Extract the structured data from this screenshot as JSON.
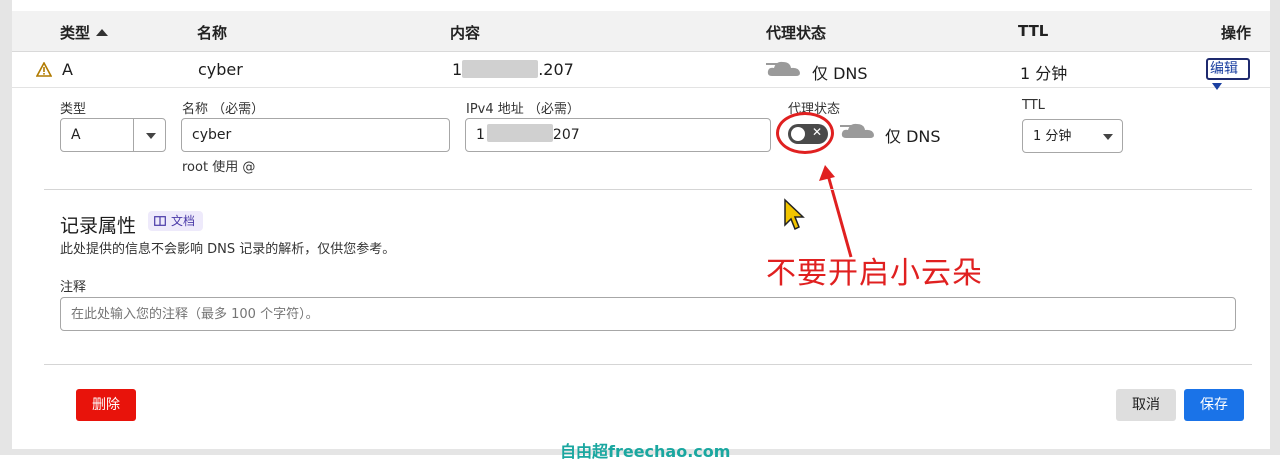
{
  "table": {
    "headers": {
      "type": "类型",
      "name": "名称",
      "content": "内容",
      "proxy": "代理状态",
      "ttl": "TTL",
      "actions": "操作"
    },
    "row": {
      "type": "A",
      "name": "cyber",
      "content_visible": ".207",
      "content_prefix": "1",
      "proxy_status": "仅 DNS",
      "ttl": "1 分钟",
      "edit_label": "编辑"
    }
  },
  "form": {
    "type_label": "类型",
    "type_value": "A",
    "name_label": "名称 （必需）",
    "name_value": "cyber",
    "name_hint": "root 使用 @",
    "ipv4_label": "IPv4 地址 （必需）",
    "ipv4_prefix": "1",
    "ipv4_suffix": "207",
    "proxy_label": "代理状态",
    "proxy_status": "仅 DNS",
    "proxy_toggle_on": false,
    "ttl_label": "TTL",
    "ttl_value": "1 分钟"
  },
  "record_props": {
    "title": "记录属性",
    "doc_label": "文档",
    "description": "此处提供的信息不会影响 DNS 记录的解析，仅供您参考。",
    "comment_label": "注释",
    "comment_placeholder": "在此处输入您的注释（最多 100 个字符）。"
  },
  "actions": {
    "delete": "删除",
    "cancel": "取消",
    "save": "保存"
  },
  "annotation": "不要开启小云朵",
  "watermark": "自由超freechao.com",
  "colors": {
    "delete": "#e8130b",
    "save": "#1a73e8",
    "annotation": "#e02020",
    "watermark": "#1aa7a0"
  }
}
